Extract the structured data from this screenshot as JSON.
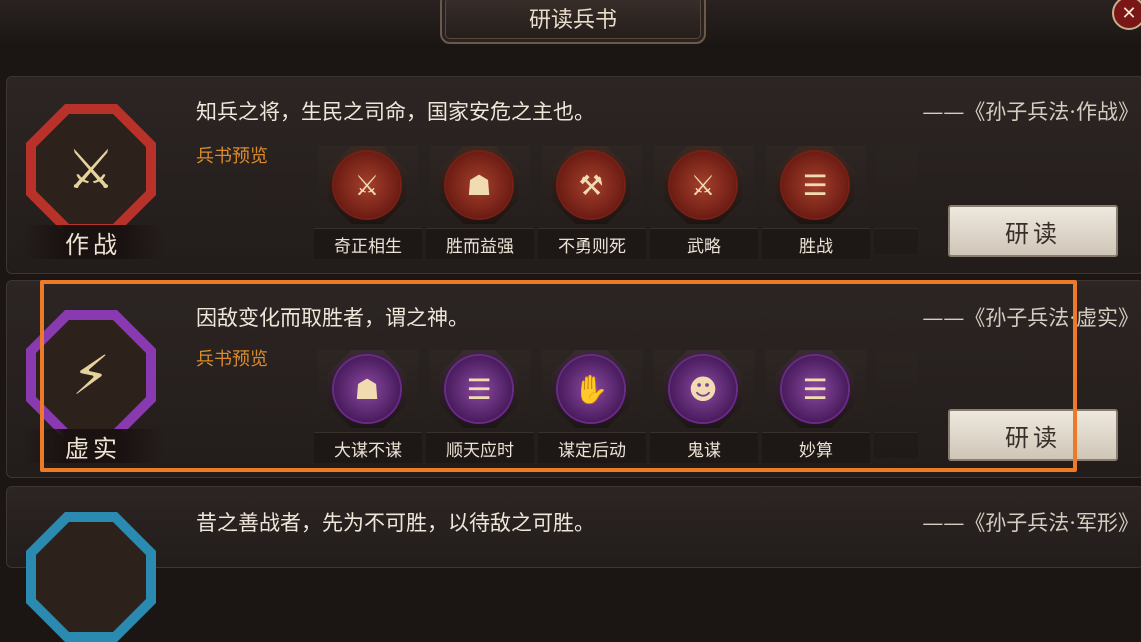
{
  "header": {
    "title": "研读兵书",
    "close_icon": "close-icon"
  },
  "books": [
    {
      "emblem_label": "作战",
      "emblem_icon": "crossed-swords-icon",
      "emblem_color": "#b8322a",
      "quote": "知兵之将，生民之司命，国家安危之主也。",
      "source": "——《孙子兵法·作战》",
      "preview_label": "兵书预览",
      "skills": [
        {
          "name": "奇正相生",
          "icon": "sword-bearer-icon"
        },
        {
          "name": "胜而益强",
          "icon": "general-icon"
        },
        {
          "name": "不勇则死",
          "icon": "warrior-icon"
        },
        {
          "name": "武略",
          "icon": "blade-icon"
        },
        {
          "name": "胜战",
          "icon": "scroll-icon"
        }
      ],
      "study_label": "研读"
    },
    {
      "emblem_label": "虚实",
      "emblem_icon": "lightning-banner-icon",
      "emblem_color": "#8a3ab0",
      "quote": "因敌变化而取胜者，谓之神。",
      "source": "——《孙子兵法·虚实》",
      "preview_label": "兵书预览",
      "skills": [
        {
          "name": "大谋不谋",
          "icon": "strategist-icon"
        },
        {
          "name": "顺天应时",
          "icon": "heaven-scroll-icon"
        },
        {
          "name": "谋定后动",
          "icon": "hand-icon"
        },
        {
          "name": "鬼谋",
          "icon": "masked-figure-icon"
        },
        {
          "name": "妙算",
          "icon": "scroll-icon"
        }
      ],
      "study_label": "研读"
    },
    {
      "quote": "昔之善战者，先为不可胜，以待敌之可胜。",
      "source": "——《孙子兵法·军形》",
      "emblem_color": "#2a8ab0"
    }
  ]
}
